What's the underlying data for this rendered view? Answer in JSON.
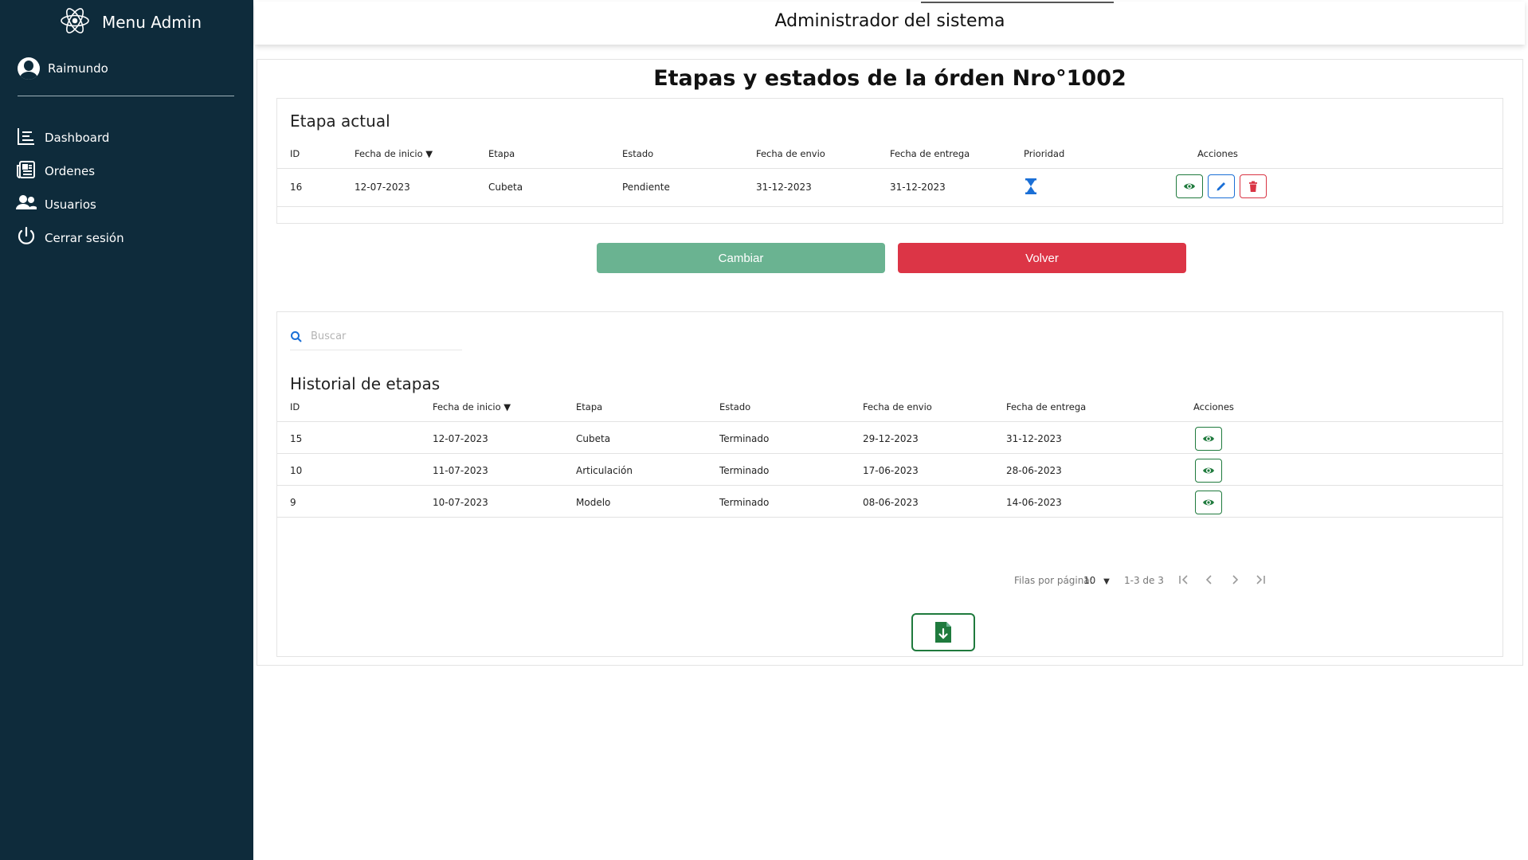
{
  "sidebar": {
    "brand_title": "Menu Admin",
    "brand_icon": "atom-icon",
    "user_name": "Raimundo",
    "items": [
      {
        "label": "Dashboard",
        "icon": "list-icon"
      },
      {
        "label": "Ordenes",
        "icon": "newspaper-icon"
      },
      {
        "label": "Usuarios",
        "icon": "users-icon"
      },
      {
        "label": "Cerrar sesión",
        "icon": "power-icon"
      }
    ]
  },
  "header": {
    "title": "Administrador del sistema"
  },
  "main": {
    "page_title": "Etapas y estados de la órden Nro°1002",
    "current_stage": {
      "title": "Etapa actual",
      "columns": [
        "ID",
        "Fecha de inicio",
        "Etapa",
        "Estado",
        "Fecha de envio",
        "Fecha de entrega",
        "Prioridad",
        "Acciones"
      ],
      "sort_indicator": "▼",
      "row": {
        "id": "16",
        "start_date": "12-07-2023",
        "stage": "Cubeta",
        "status": "Pendiente",
        "send_date": "31-12-2023",
        "delivery_date": "31-12-2023",
        "priority_icon": "hourglass-icon"
      }
    },
    "buttons": {
      "cambiar": "Cambiar",
      "volver": "Volver"
    },
    "history": {
      "search_placeholder": "Buscar",
      "title": "Historial de etapas",
      "columns": [
        "ID",
        "Fecha de inicio",
        "Etapa",
        "Estado",
        "Fecha de envio",
        "Fecha de entrega",
        "Acciones"
      ],
      "rows": [
        {
          "id": "15",
          "start_date": "12-07-2023",
          "stage": "Cubeta",
          "status": "Terminado",
          "send_date": "29-12-2023",
          "delivery_date": "31-12-2023"
        },
        {
          "id": "10",
          "start_date": "11-07-2023",
          "stage": "Articulación",
          "status": "Terminado",
          "send_date": "17-06-2023",
          "delivery_date": "28-06-2023"
        },
        {
          "id": "9",
          "start_date": "10-07-2023",
          "stage": "Modelo",
          "status": "Terminado",
          "send_date": "08-06-2023",
          "delivery_date": "14-06-2023"
        }
      ],
      "pagination": {
        "rows_per_page_label": "Filas por página:",
        "rows_per_page": "10",
        "range": "1-3 de 3"
      }
    }
  },
  "colors": {
    "sidebar_bg": "#0e2b3b",
    "cambiar": "#6ab391",
    "volver": "#dc3546",
    "view": "#1f7a3d",
    "edit": "#1a6fd6",
    "delete": "#d93444"
  }
}
